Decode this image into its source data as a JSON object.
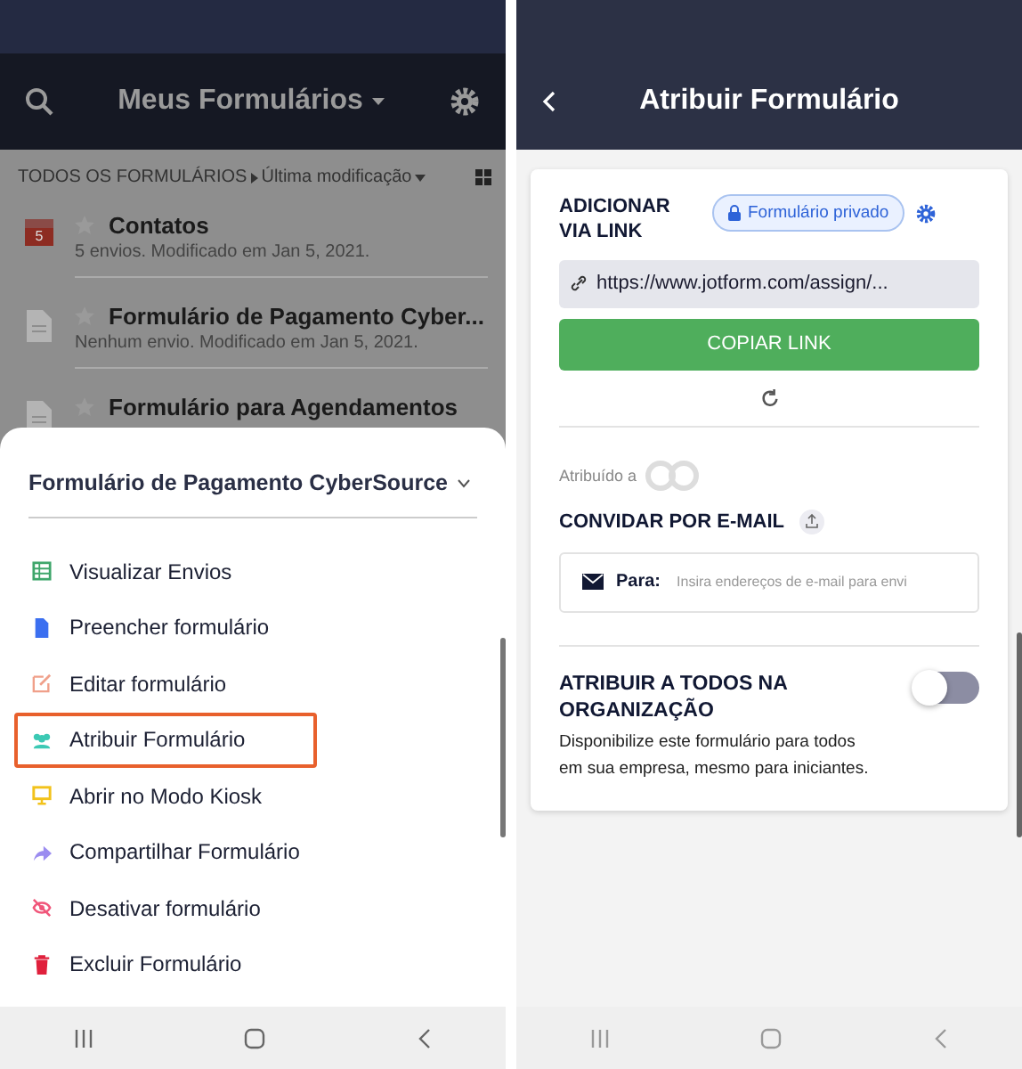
{
  "left": {
    "header_title": "Meus Formulários",
    "filter": {
      "folder": "TODOS OS FORMULÁRIOS",
      "sort": "Última modificação"
    },
    "forms": [
      {
        "kind": "inbox",
        "badge": "5",
        "title": "Contatos",
        "subtitle": "5 envios. Modificado em Jan 5, 2021."
      },
      {
        "kind": "doc",
        "title": "Formulário de Pagamento Cyber...",
        "subtitle": "Nenhum envio. Modificado em Jan 5, 2021."
      },
      {
        "kind": "doc",
        "title": "Formulário para Agendamentos"
      }
    ],
    "sheet": {
      "title": "Formulário de Pagamento CyberSource",
      "actions": [
        {
          "kind": "table",
          "label": "Visualizar Envios",
          "color": "#3fa66b",
          "highlighted": false
        },
        {
          "kind": "doc",
          "label": "Preencher formulário",
          "color": "#3b6ff0",
          "highlighted": false
        },
        {
          "kind": "edit",
          "label": "Editar formulário",
          "color": "#f0a08a",
          "highlighted": false
        },
        {
          "kind": "people",
          "label": "Atribuir Formulário",
          "color": "#3cc9b4",
          "highlighted": true
        },
        {
          "kind": "monitor",
          "label": "Abrir no Modo Kiosk",
          "color": "#f2c21b",
          "highlighted": false
        },
        {
          "kind": "share",
          "label": "Compartilhar Formulário",
          "color": "#9b8cf0",
          "highlighted": false
        },
        {
          "kind": "hidden",
          "label": "Desativar formulário",
          "color": "#f0567a",
          "highlighted": false
        },
        {
          "kind": "trash",
          "label": "Excluir Formulário",
          "color": "#e0203c",
          "highlighted": false
        }
      ]
    }
  },
  "right": {
    "header_title": "Atribuir Formulário",
    "link_section": {
      "title": "ADICIONAR VIA LINK",
      "privacy_badge": "Formulário privado",
      "url": "https://www.jotform.com/assign/...",
      "copy_button": "COPIAR LINK"
    },
    "assigned_label": "Atribuído a",
    "email_section": {
      "title": "CONVIDAR POR E-MAIL",
      "to_label": "Para:",
      "placeholder": "Insira endereços de e-mail para envi"
    },
    "organization": {
      "title": "ATRIBUIR A TODOS NA ORGANIZAÇÃO",
      "description": "Disponibilize este formulário para todos em sua empresa, mesmo para iniciantes.",
      "on": false
    }
  }
}
